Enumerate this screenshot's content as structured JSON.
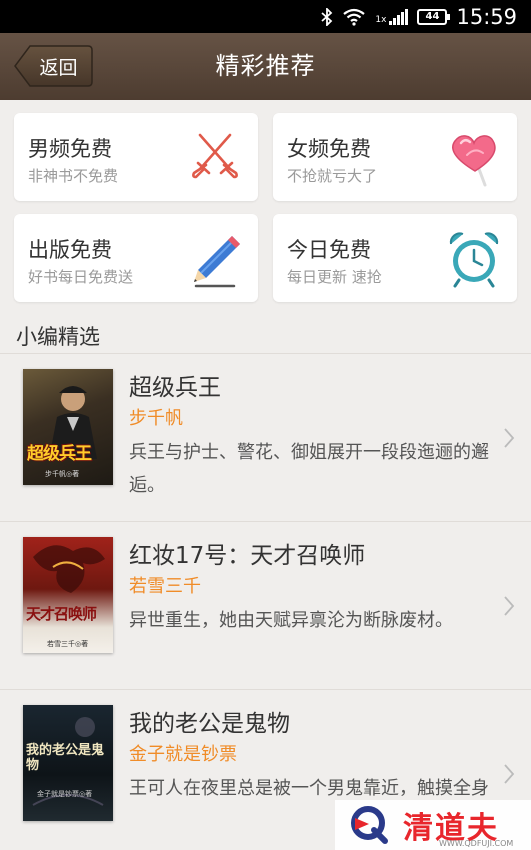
{
  "status_bar": {
    "time": "15:59",
    "battery": "44",
    "signal_label": "1x"
  },
  "header": {
    "back_label": "返回",
    "title": "精彩推荐"
  },
  "categories": [
    {
      "title": "男频免费",
      "subtitle": "非神书不免费",
      "icon": "crossed-swords-icon"
    },
    {
      "title": "女频免费",
      "subtitle": "不抢就亏大了",
      "icon": "heart-lollipop-icon"
    },
    {
      "title": "出版免费",
      "subtitle": "好书每日免费送",
      "icon": "pencil-icon"
    },
    {
      "title": "今日免费",
      "subtitle": "每日更新 速抢",
      "icon": "alarm-clock-icon"
    }
  ],
  "section": {
    "title": "小编精选"
  },
  "books": [
    {
      "title": "超级兵王",
      "author": "步千帆",
      "description": "兵王与护士、警花、御姐展开一段段迤逦的邂逅。",
      "cover_text": "超级兵王",
      "cover_author": "步千帆◎著"
    },
    {
      "title": "红妆17号：天才召唤师",
      "author": "若雪三千",
      "description": "异世重生，她由天赋异禀沦为断脉废材。",
      "cover_text": "天才召唤师",
      "cover_author": "若雪三千◎著"
    },
    {
      "title": "我的老公是鬼物",
      "author": "金子就是钞票",
      "description": "王可人在夜里总是被一个男鬼靠近，触摸全身",
      "cover_text": "我的老公是鬼物",
      "cover_author": "金子就是钞票◎著"
    }
  ],
  "watermark": {
    "text": "清道夫",
    "url": "WWW.QDFUJI.COM"
  },
  "colors": {
    "header": "#5a4738",
    "accent": "#f08c28",
    "background": "#f0eeec"
  }
}
